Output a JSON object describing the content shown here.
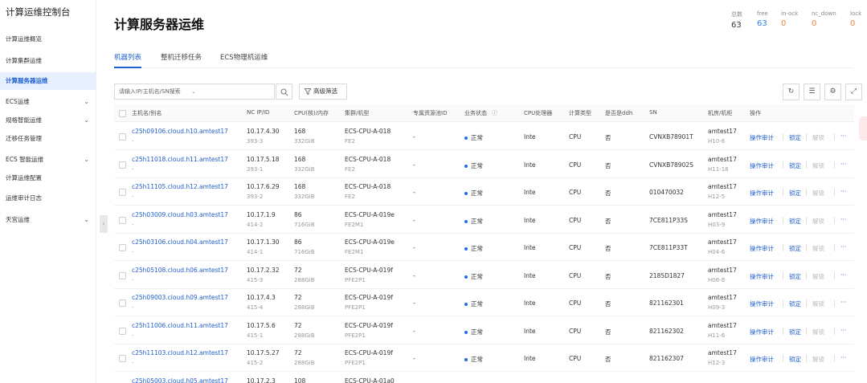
{
  "sidebar": {
    "title": "计算运维控制台",
    "items": [
      {
        "label": "计算运维概览",
        "chevron": ""
      },
      {
        "label": "计算集群运维",
        "chevron": ""
      },
      {
        "label": "计算服务器运维",
        "chevron": ""
      },
      {
        "label": "ECS运维",
        "chevron": "⌄"
      },
      {
        "label": "规格智能运维",
        "chevron": "⌄"
      },
      {
        "label": "迁移任务管理",
        "chevron": ""
      },
      {
        "label": "ECS 智能运维",
        "chevron": "⌄"
      },
      {
        "label": "计算运维配置",
        "chevron": ""
      },
      {
        "label": "运维审计日志",
        "chevron": ""
      },
      {
        "label": "天宫运维",
        "chevron": "⌄"
      }
    ],
    "collapse_glyph": "‹"
  },
  "page": {
    "title": "计算服务器运维"
  },
  "stats": [
    {
      "label": "总数",
      "value": "63",
      "color": "#333333"
    },
    {
      "label": "free",
      "value": "63",
      "color": "#2f80ed"
    },
    {
      "label": "in-ock",
      "value": "0",
      "color": "#f0883e"
    },
    {
      "label": "nc_down",
      "value": "0",
      "color": "#f0883e"
    },
    {
      "label": "lock",
      "value": "0",
      "color": "#f0883e"
    }
  ],
  "tabs": [
    "机器列表",
    "整机迁移任务",
    "ECS物理机运维"
  ],
  "toolbar": {
    "search_placeholder": "请输入IP/主机名/SN搜索",
    "dropdown_glyph": "⌄",
    "search_icon": "search-icon",
    "filter_label": "高级筛选",
    "icons": [
      "refresh-icon",
      "column-settings-icon",
      "settings-icon",
      "fullscreen-icon"
    ]
  },
  "table": {
    "headers": [
      "主机名/别名",
      "NC IP/ID",
      "CPU(核)/内存",
      "集群/机型",
      "专属资源池ID",
      "业务状态",
      "CPU处理器",
      "计算类型",
      "是否是ddh",
      "SN",
      "机房/机柜",
      "操作"
    ],
    "rows": [
      {
        "host": "c25h09106.cloud.h10.amtest17",
        "alias": "-",
        "ip": "10.17.4.30",
        "id": "393-3",
        "cpu": "168",
        "mem": "332GiB",
        "cluster": "ECS-CPU-A-018",
        "model": "FE2",
        "pool": "-",
        "status": "正常",
        "processor": "Inte",
        "ctype": "CPU",
        "ddh": "否",
        "sn": "CVNXB78901T",
        "room": "amtest17",
        "rack": "H10-6"
      },
      {
        "host": "c25h11018.cloud.h11.amtest17",
        "alias": "-",
        "ip": "10.17.5.18",
        "id": "393-1",
        "cpu": "168",
        "mem": "332GiB",
        "cluster": "ECS-CPU-A-018",
        "model": "FE2",
        "pool": "-",
        "status": "正常",
        "processor": "Inte",
        "ctype": "CPU",
        "ddh": "否",
        "sn": "CVNXB78902S",
        "room": "amtest17",
        "rack": "H11-18"
      },
      {
        "host": "c25h11105.cloud.h12.amtest17",
        "alias": "-",
        "ip": "10.17.6.29",
        "id": "393-2",
        "cpu": "168",
        "mem": "332GiB",
        "cluster": "ECS-CPU-A-018",
        "model": "FE2",
        "pool": "-",
        "status": "正常",
        "processor": "Inte",
        "ctype": "CPU",
        "ddh": "否",
        "sn": "010470032",
        "room": "amtest17",
        "rack": "H12-5"
      },
      {
        "host": "c25h03009.cloud.h03.amtest17",
        "alias": "-",
        "ip": "10.17.1.9",
        "id": "414-2",
        "cpu": "86",
        "mem": "716GiB",
        "cluster": "ECS-CPU-A-019e",
        "model": "FE2M1",
        "pool": "-",
        "status": "正常",
        "processor": "Inte",
        "ctype": "CPU",
        "ddh": "否",
        "sn": "7CE811P33S",
        "room": "amtest17",
        "rack": "H03-9"
      },
      {
        "host": "c25h03106.cloud.h04.amtest17",
        "alias": "-",
        "ip": "10.17.1.30",
        "id": "414-1",
        "cpu": "86",
        "mem": "716GiB",
        "cluster": "ECS-CPU-A-019e",
        "model": "FE2M1",
        "pool": "-",
        "status": "正常",
        "processor": "Inte",
        "ctype": "CPU",
        "ddh": "否",
        "sn": "7CE811P33T",
        "room": "amtest17",
        "rack": "H04-6"
      },
      {
        "host": "c25h05108.cloud.h06.amtest17",
        "alias": "-",
        "ip": "10.17.2.32",
        "id": "415-3",
        "cpu": "72",
        "mem": "288GiB",
        "cluster": "ECS-CPU-A-019f",
        "model": "PFE2P1",
        "pool": "-",
        "status": "正常",
        "processor": "Inte",
        "ctype": "CPU",
        "ddh": "否",
        "sn": "2185D1827",
        "room": "amtest17",
        "rack": "H06-8"
      },
      {
        "host": "c25h09003.cloud.h09.amtest17",
        "alias": "-",
        "ip": "10.17.4.3",
        "id": "415-4",
        "cpu": "72",
        "mem": "288GiB",
        "cluster": "ECS-CPU-A-019f",
        "model": "PFE2P1",
        "pool": "-",
        "status": "正常",
        "processor": "Inte",
        "ctype": "CPU",
        "ddh": "否",
        "sn": "821162301",
        "room": "amtest17",
        "rack": "H09-3"
      },
      {
        "host": "c25h11006.cloud.h11.amtest17",
        "alias": "-",
        "ip": "10.17.5.6",
        "id": "415-1",
        "cpu": "72",
        "mem": "288GiB",
        "cluster": "ECS-CPU-A-019f",
        "model": "PFE2P1",
        "pool": "-",
        "status": "正常",
        "processor": "Inte",
        "ctype": "CPU",
        "ddh": "否",
        "sn": "821162302",
        "room": "amtest17",
        "rack": "H11-6"
      },
      {
        "host": "c25h11103.cloud.h12.amtest17",
        "alias": "-",
        "ip": "10.17.5.27",
        "id": "415-2",
        "cpu": "72",
        "mem": "288GiB",
        "cluster": "ECS-CPU-A-019f",
        "model": "PFE2P1",
        "pool": "-",
        "status": "正常",
        "processor": "Inte",
        "ctype": "CPU",
        "ddh": "否",
        "sn": "821162307",
        "room": "amtest17",
        "rack": "H12-3"
      },
      {
        "host": "c25h05003.cloud.h05.amtest17",
        "alias": "-",
        "ip": "10.17.2.3",
        "id": "",
        "cpu": "108",
        "mem": "",
        "cluster": "ECS-CPU-A-01a0",
        "model": "",
        "pool": "",
        "status": "",
        "processor": "",
        "ctype": "",
        "ddh": "",
        "sn": "",
        "room": "",
        "rack": ""
      }
    ],
    "actions": {
      "audit": "操作审计",
      "lock": "锁定",
      "unlock": "解锁",
      "more": "···"
    }
  }
}
